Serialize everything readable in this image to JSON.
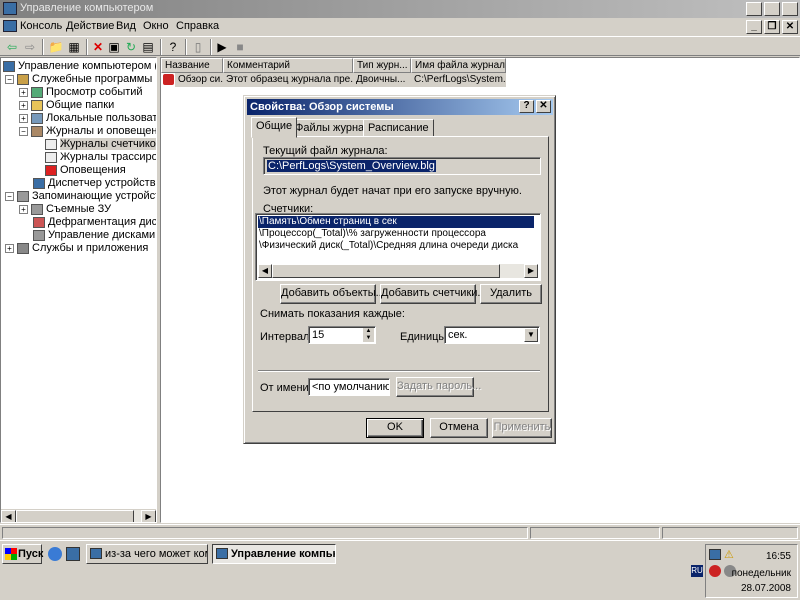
{
  "window": {
    "title": "Управление компьютером",
    "min": "_",
    "max": "❐",
    "close": "✕"
  },
  "menu": [
    "Консоль",
    "Действие",
    "Вид",
    "Окно",
    "Справка"
  ],
  "tree": {
    "root": "Управление компьютером (локаль",
    "items": [
      "Служебные программы",
      "Просмотр событий",
      "Общие папки",
      "Локальные пользователи и",
      "Журналы и оповещения пр",
      "Журналы счетчиков",
      "Журналы трассировки",
      "Оповещения",
      "Диспетчер устройств",
      "Запоминающие устройства",
      "Съемные ЗУ",
      "Дефрагментация диска",
      "Управление дисками",
      "Службы и приложения"
    ]
  },
  "list": {
    "columns": [
      "Название",
      "Комментарий",
      "Тип журн...",
      "Имя файла журнала"
    ],
    "row": [
      "Обзор си...",
      "Этот образец журнала пре...",
      "Двоичны...",
      "C:\\PerfLogs\\System..."
    ]
  },
  "dialog": {
    "title": "Свойства: Обзор системы",
    "help": "?",
    "close": "✕",
    "tabs": [
      "Общие",
      "Файлы журнала",
      "Расписание"
    ],
    "current_file_label": "Текущий файл журнала:",
    "current_file": "C:\\PerfLogs\\System_Overview.blg",
    "start_note": "Этот журнал будет начат при его запуске вручную.",
    "counters_label": "Счетчики:",
    "counters": [
      "\\Память\\Обмен страниц в сек",
      "\\Процессор(_Total)\\% загруженности процессора",
      "\\Физический диск(_Total)\\Средняя длина очереди диска"
    ],
    "add_objects": "Добавить объекты...",
    "add_counters": "Добавить счетчики...",
    "remove": "Удалить",
    "sample_label": "Снимать показания каждые:",
    "interval_label": "Интервал:",
    "interval_value": "15",
    "units_label": "Единицы:",
    "units_value": "сек.",
    "run_as_label": "От имени:",
    "run_as_value": "<по умолчанию>",
    "set_password": "Задать пароль...",
    "ok": "OK",
    "cancel": "Отмена",
    "apply": "Применить"
  },
  "taskbar": {
    "start": "Пуск",
    "tasks": [
      "из-за чего может комп ...",
      "Управление компью..."
    ],
    "lang": "RU",
    "time": "16:55",
    "day": "понедельник",
    "date": "28.07.2008"
  }
}
